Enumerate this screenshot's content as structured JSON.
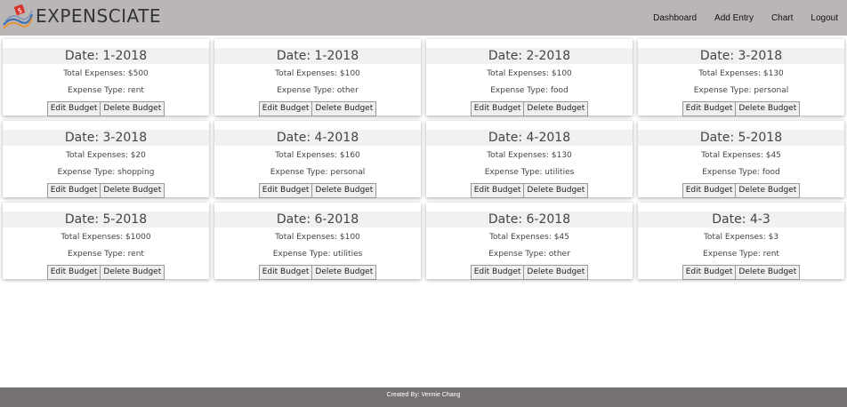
{
  "app": {
    "brand_name": "EXPENSCIATE",
    "logo_icon": "chart-logo-icon"
  },
  "nav": {
    "items": [
      "Dashboard",
      "Add Entry",
      "Chart",
      "Logout"
    ]
  },
  "card_labels": {
    "date_prefix": "Date: ",
    "total_prefix": "Total Expenses: $",
    "type_prefix": "Expense Type: ",
    "edit_label": "Edit Budget",
    "delete_label": "Delete Budget"
  },
  "budgets": [
    {
      "date": "1-2018",
      "total": "500",
      "type": "rent"
    },
    {
      "date": "1-2018",
      "total": "100",
      "type": "other"
    },
    {
      "date": "2-2018",
      "total": "100",
      "type": "food"
    },
    {
      "date": "3-2018",
      "total": "130",
      "type": "personal"
    },
    {
      "date": "3-2018",
      "total": "20",
      "type": "shopping"
    },
    {
      "date": "4-2018",
      "total": "160",
      "type": "personal"
    },
    {
      "date": "4-2018",
      "total": "130",
      "type": "utilities"
    },
    {
      "date": "5-2018",
      "total": "45",
      "type": "food"
    },
    {
      "date": "5-2018",
      "total": "1000",
      "type": "rent"
    },
    {
      "date": "6-2018",
      "total": "100",
      "type": "utilities"
    },
    {
      "date": "6-2018",
      "total": "45",
      "type": "other"
    },
    {
      "date": "4-3",
      "total": "3",
      "type": "rent"
    }
  ],
  "footer": {
    "text": "Created By: Vennie Chang"
  },
  "colors": {
    "navbar_bg": "#bab6b6",
    "footer_bg": "#757171",
    "date_band_bg": "#f1f1f1",
    "logo_red": "#d9342b",
    "logo_blue": "#3b6fb5",
    "logo_orange": "#e8923a"
  }
}
